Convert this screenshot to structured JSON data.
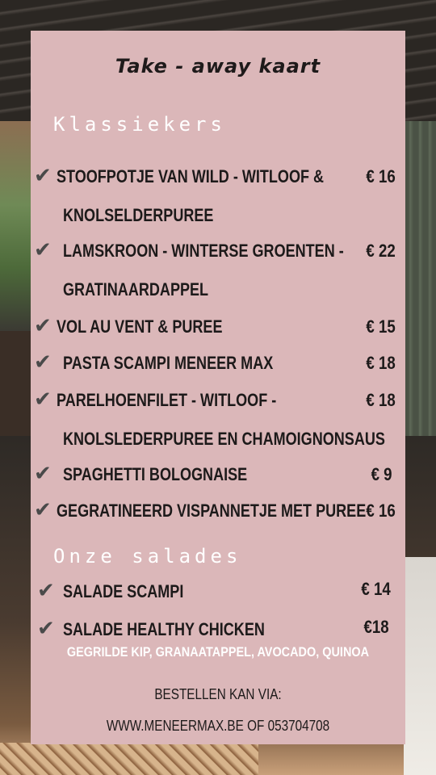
{
  "menu": {
    "title": "Take - away kaart",
    "sections": [
      {
        "heading": "Klassiekers",
        "items": [
          {
            "line1": "STOOFPOTJE VAN WILD - WITLOOF &",
            "line2": "KNOLSELDERPUREE",
            "price": "€ 16"
          },
          {
            "line1": "LAMSKROON - WINTERSE GROENTEN -",
            "line2": "GRATINAARDAPPEL",
            "price": "€ 22"
          },
          {
            "line1": "VOL AU VENT & PUREE",
            "price": "€ 15"
          },
          {
            "line1": "PASTA SCAMPI MENEER MAX",
            "price": "€ 18"
          },
          {
            "line1": "PARELHOENFILET - WITLOOF -",
            "line2": "KNOLSLEDERPUREE EN CHAMOIGNONSAUS",
            "price": "€ 18"
          },
          {
            "line1": "SPAGHETTI BOLOGNAISE",
            "price": "€ 9"
          },
          {
            "line1": "GEGRATINEERD VISPANNETJE MET PUREE",
            "price": "€ 16"
          }
        ]
      },
      {
        "heading": "Onze salades",
        "items": [
          {
            "line1": "SALADE SCAMPI",
            "price": "€ 14"
          },
          {
            "line1": "SALADE HEALTHY CHICKEN",
            "price": "€18",
            "note": "GEGRILDE KIP, GRANAATAPPEL, AVOCADO, QUINOA"
          }
        ]
      }
    ],
    "footer": {
      "line1": "BESTELLEN KAN VIA:",
      "line2": "WWW.MENEERMAX.BE OF 053704708"
    }
  },
  "icons": {
    "check": "check-mark-icon"
  },
  "colors": {
    "card": "#dbb7b9",
    "text": "#1d1a1a",
    "heading": "#ffffff"
  }
}
